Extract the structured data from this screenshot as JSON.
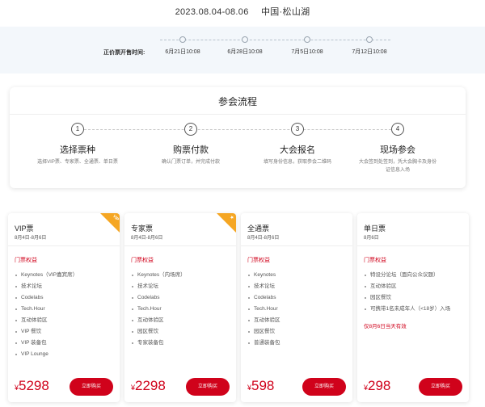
{
  "header": {
    "date": "2023.08.04-08.06",
    "location": "中国·松山湖"
  },
  "sale": {
    "label": "正价票开售时间:",
    "dates": [
      "6月21日10:08",
      "6月28日10:08",
      "7月5日10:08",
      "7月12日10:08"
    ]
  },
  "flow": {
    "title": "参会流程",
    "steps": [
      {
        "num": "1",
        "title": "选择票种",
        "desc": "选择VIP票、专家票、全通票、单日票"
      },
      {
        "num": "2",
        "title": "购票付款",
        "desc": "确认门票订单，并完成付款"
      },
      {
        "num": "3",
        "title": "大会报名",
        "desc": "填写身份信息，获取参会二维码"
      },
      {
        "num": "4",
        "title": "现场参会",
        "desc": "大会签到处签到，凭大会胸卡及身份证信息入场"
      }
    ]
  },
  "tickets": [
    {
      "name": "VIP票",
      "date": "8月4日-8月6日",
      "rights_label": "门票权益",
      "ribbon": "VIP",
      "items": [
        "Keynotes（VIP嘉宾席）",
        "技术论坛",
        "Codelabs",
        "Tech.Hour",
        "互动体验区",
        "VIP 餐饮",
        "VIP 装备包",
        "VIP Lounge"
      ],
      "currency": "¥",
      "price": "5298",
      "buy_label": "立即购买"
    },
    {
      "name": "专家票",
      "date": "8月4日-8月6日",
      "rights_label": "门票权益",
      "ribbon": "★",
      "items": [
        "Keynotes（内场席）",
        "技术论坛",
        "Codelabs",
        "Tech.Hour",
        "互动体验区",
        "园区餐饮",
        "专家装备包"
      ],
      "currency": "¥",
      "price": "2298",
      "buy_label": "立即购买"
    },
    {
      "name": "全通票",
      "date": "8月4日-8月6日",
      "rights_label": "门票权益",
      "items": [
        "Keynotes",
        "技术论坛",
        "Codelabs",
        "Tech.Hour",
        "互动体验区",
        "园区餐饮",
        "普通装备包"
      ],
      "currency": "¥",
      "price": "598",
      "buy_label": "立即购买"
    },
    {
      "name": "单日票",
      "date": "8月6日",
      "rights_label": "门票权益",
      "items": [
        "特设分论坛（面向公众议题）",
        "互动体验区",
        "园区餐饮",
        "可携带1名未成年人（<18岁）入场"
      ],
      "note": "仅8月6日当天有效",
      "currency": "¥",
      "price": "298",
      "buy_label": "立即购买"
    }
  ],
  "colors": {
    "accent": "#d0021b",
    "ribbon": "#f5a623",
    "band": "#f3f7fb"
  }
}
